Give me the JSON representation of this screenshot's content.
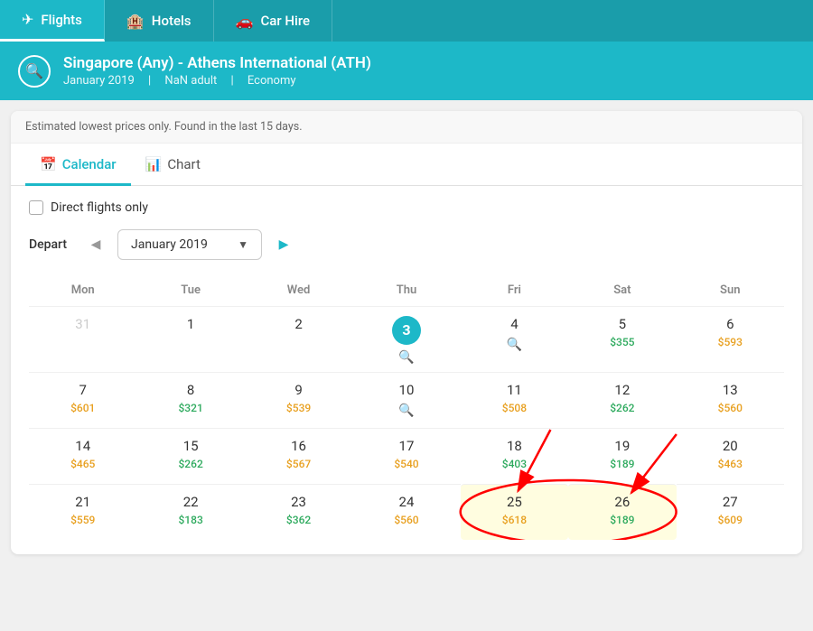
{
  "nav": {
    "tabs": [
      {
        "id": "flights",
        "label": "Flights",
        "icon": "✈",
        "active": true
      },
      {
        "id": "hotels",
        "label": "Hotels",
        "icon": "🏨",
        "active": false
      },
      {
        "id": "car-hire",
        "label": "Car Hire",
        "icon": "🚗",
        "active": false
      }
    ]
  },
  "search": {
    "route": "Singapore (Any) - Athens International (ATH)",
    "month": "January 2019",
    "adults": "NaN adult",
    "class": "Economy"
  },
  "notice": "Estimated lowest prices only. Found in the last 15 days.",
  "view_tabs": [
    {
      "id": "calendar",
      "label": "Calendar",
      "icon": "📅",
      "active": true
    },
    {
      "id": "chart",
      "label": "Chart",
      "icon": "📊",
      "active": false
    }
  ],
  "direct_flights": {
    "label": "Direct flights only",
    "checked": false
  },
  "depart": {
    "label": "Depart",
    "month": "January 2019"
  },
  "calendar": {
    "headers": [
      "Mon",
      "Tue",
      "Wed",
      "Thu",
      "Fri",
      "Sat",
      "Sun"
    ],
    "weeks": [
      [
        {
          "day": "31",
          "muted": true,
          "price": null,
          "price_color": null,
          "today": false,
          "search": false,
          "highlighted": false
        },
        {
          "day": "1",
          "muted": false,
          "price": null,
          "price_color": null,
          "today": false,
          "search": false,
          "highlighted": false
        },
        {
          "day": "2",
          "muted": false,
          "price": null,
          "price_color": null,
          "today": false,
          "search": false,
          "highlighted": false
        },
        {
          "day": "3",
          "muted": false,
          "price": null,
          "price_color": null,
          "today": true,
          "search": true,
          "highlighted": false
        },
        {
          "day": "4",
          "muted": false,
          "price": null,
          "price_color": null,
          "today": false,
          "search": true,
          "highlighted": false
        },
        {
          "day": "5",
          "muted": false,
          "price": "$355",
          "price_color": "green",
          "today": false,
          "search": false,
          "highlighted": false
        },
        {
          "day": "6",
          "muted": false,
          "price": "$593",
          "price_color": "orange",
          "today": false,
          "search": false,
          "highlighted": false
        }
      ],
      [
        {
          "day": "7",
          "muted": false,
          "price": "$601",
          "price_color": "orange",
          "today": false,
          "search": false,
          "highlighted": false
        },
        {
          "day": "8",
          "muted": false,
          "price": "$321",
          "price_color": "green",
          "today": false,
          "search": false,
          "highlighted": false
        },
        {
          "day": "9",
          "muted": false,
          "price": "$539",
          "price_color": "orange",
          "today": false,
          "search": false,
          "highlighted": false
        },
        {
          "day": "10",
          "muted": false,
          "price": null,
          "price_color": null,
          "today": false,
          "search": true,
          "highlighted": false
        },
        {
          "day": "11",
          "muted": false,
          "price": "$508",
          "price_color": "orange",
          "today": false,
          "search": false,
          "highlighted": false
        },
        {
          "day": "12",
          "muted": false,
          "price": "$262",
          "price_color": "green",
          "today": false,
          "search": false,
          "highlighted": false
        },
        {
          "day": "13",
          "muted": false,
          "price": "$560",
          "price_color": "orange",
          "today": false,
          "search": false,
          "highlighted": false
        }
      ],
      [
        {
          "day": "14",
          "muted": false,
          "price": "$465",
          "price_color": "orange",
          "today": false,
          "search": false,
          "highlighted": false
        },
        {
          "day": "15",
          "muted": false,
          "price": "$262",
          "price_color": "green",
          "today": false,
          "search": false,
          "highlighted": false
        },
        {
          "day": "16",
          "muted": false,
          "price": "$567",
          "price_color": "orange",
          "today": false,
          "search": false,
          "highlighted": false
        },
        {
          "day": "17",
          "muted": false,
          "price": "$540",
          "price_color": "orange",
          "today": false,
          "search": false,
          "highlighted": false
        },
        {
          "day": "18",
          "muted": false,
          "price": "$403",
          "price_color": "green",
          "today": false,
          "search": false,
          "highlighted": false
        },
        {
          "day": "19",
          "muted": false,
          "price": "$189",
          "price_color": "green",
          "today": false,
          "search": false,
          "highlighted": false
        },
        {
          "day": "20",
          "muted": false,
          "price": "$463",
          "price_color": "orange",
          "today": false,
          "search": false,
          "highlighted": false
        }
      ],
      [
        {
          "day": "21",
          "muted": false,
          "price": "$559",
          "price_color": "orange",
          "today": false,
          "search": false,
          "highlighted": false
        },
        {
          "day": "22",
          "muted": false,
          "price": "$183",
          "price_color": "green",
          "today": false,
          "search": false,
          "highlighted": false
        },
        {
          "day": "23",
          "muted": false,
          "price": "$362",
          "price_color": "green",
          "today": false,
          "search": false,
          "highlighted": false
        },
        {
          "day": "24",
          "muted": false,
          "price": "$560",
          "price_color": "orange",
          "today": false,
          "search": false,
          "highlighted": false
        },
        {
          "day": "25",
          "muted": false,
          "price": "$618",
          "price_color": "orange",
          "today": false,
          "search": false,
          "highlighted": true
        },
        {
          "day": "26",
          "muted": false,
          "price": "$189",
          "price_color": "green",
          "today": false,
          "search": false,
          "highlighted": true
        },
        {
          "day": "27",
          "muted": false,
          "price": "$609",
          "price_color": "orange",
          "today": false,
          "search": false,
          "highlighted": false
        }
      ]
    ]
  }
}
